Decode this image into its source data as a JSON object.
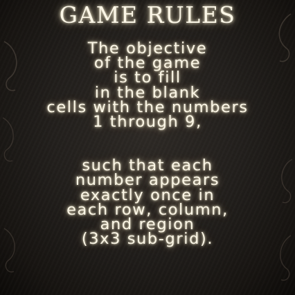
{
  "title": "GAME RULES",
  "rules": {
    "paragraph1": [
      "The objective",
      "of the game",
      "is to fill",
      "in the blank",
      "cells with the numbers",
      "1 through 9,"
    ],
    "paragraph2": [
      "such that each",
      "number appears",
      "exactly once in",
      "each row, column,",
      "and region",
      "(3x3 sub-grid)."
    ]
  },
  "colors": {
    "background": "#23201d",
    "text": "#fbf6e6",
    "glow": "#fff0c8",
    "ornament": "#5a5047"
  },
  "icons": [
    "left-ornament-icon",
    "right-ornament-icon"
  ]
}
